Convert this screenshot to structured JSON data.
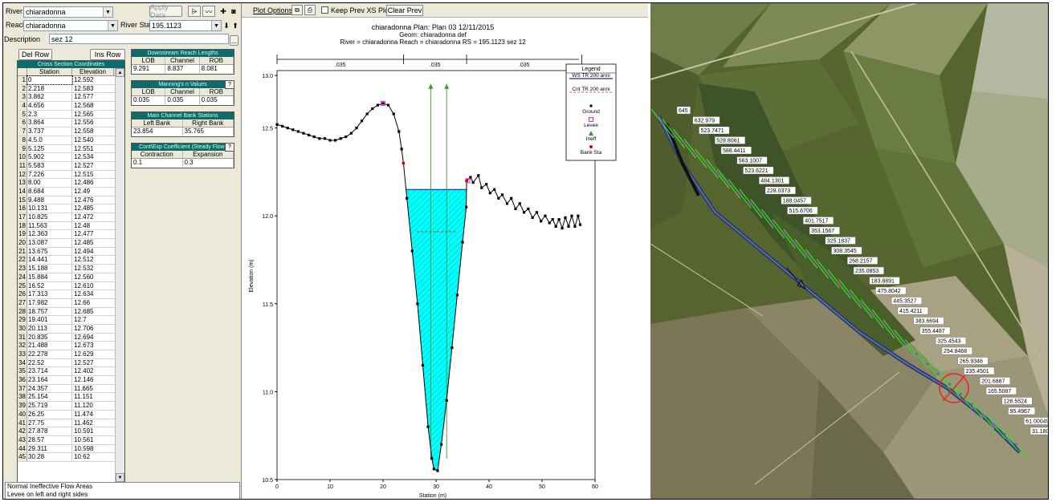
{
  "editor": {
    "river_label": "River:",
    "river_value": "chiaradonna",
    "reach_label": "Reach:",
    "reach_value": "chiaradonna",
    "river_sta_label": "River Sta.:",
    "river_sta_value": "195.1123",
    "description_label": "Description",
    "description_value": "sez 12",
    "apply_data_label": "Apply Data",
    "del_row_label": "Del Row",
    "ins_row_label": "Ins Row",
    "ellipsis_label": "...",
    "coord_title": "Cross Section Coordinates",
    "coord_headers": [
      "Station",
      "Elevation"
    ],
    "coords": [
      [
        "0",
        "12.592"
      ],
      [
        "2.218",
        "12.583"
      ],
      [
        "3.862",
        "12.577"
      ],
      [
        "4.656",
        "12.568"
      ],
      [
        "2.3",
        "12.565"
      ],
      [
        "3.864",
        "12.556"
      ],
      [
        "3.737",
        "12.558"
      ],
      [
        "4.5.0",
        "12.540"
      ],
      [
        "5.125",
        "12.551"
      ],
      [
        "5.902",
        "12.534"
      ],
      [
        "5.583",
        "12.527"
      ],
      [
        "7.226",
        "12.515"
      ],
      [
        "8.00",
        "12.486"
      ],
      [
        "8.684",
        "12.49"
      ],
      [
        "9.488",
        "12.476"
      ],
      [
        "10.131",
        "12.485"
      ],
      [
        "10.825",
        "12.472"
      ],
      [
        "11.563",
        "12.48"
      ],
      [
        "12.363",
        "12.477"
      ],
      [
        "13.087",
        "12.485"
      ],
      [
        "13.675",
        "12.494"
      ],
      [
        "14.441",
        "12.512"
      ],
      [
        "15.188",
        "12.532"
      ],
      [
        "15.884",
        "12.560"
      ],
      [
        "16.52",
        "12.610"
      ],
      [
        "17.313",
        "12.634"
      ],
      [
        "17.982",
        "12.66"
      ],
      [
        "18.757",
        "12.685"
      ],
      [
        "19.401",
        "12.7"
      ],
      [
        "20.113",
        "12.706"
      ],
      [
        "20.835",
        "12.694"
      ],
      [
        "21.488",
        "12.673"
      ],
      [
        "22.278",
        "12.629"
      ],
      [
        "22.52",
        "12.527"
      ],
      [
        "23.714",
        "12.402"
      ],
      [
        "23.164",
        "12.146"
      ],
      [
        "24.357",
        "11.665"
      ],
      [
        "25.154",
        "11.151"
      ],
      [
        "25.719",
        "11.120"
      ],
      [
        "26.25",
        "11.474"
      ],
      [
        "27.75",
        "11.462"
      ],
      [
        "27.878",
        "10.591"
      ],
      [
        "28.57",
        "10.561"
      ],
      [
        "29.311",
        "10.598"
      ],
      [
        "30.28",
        "10.62"
      ]
    ],
    "reach_lengths": {
      "title": "Downstream Reach Lengths",
      "headers": [
        "LOB",
        "Channel",
        "ROB"
      ],
      "values": [
        "9.291",
        "8.837",
        "8.081"
      ]
    },
    "mannings": {
      "title": "Manning's n Values",
      "help": "?",
      "headers": [
        "LOB",
        "Channel",
        "ROB"
      ],
      "values": [
        "0.035",
        "0.035",
        "0.035"
      ]
    },
    "bank_stations": {
      "title": "Main Channel Bank Stations",
      "headers": [
        "Left Bank",
        "Right Bank"
      ],
      "values": [
        "23.854",
        "35.765"
      ]
    },
    "coeff": {
      "title": "Cont\\Exp Coefficient (Steady Flow)",
      "help": "?",
      "headers": [
        "Contraction",
        "Expansion"
      ],
      "values": [
        "0.1",
        "0.3"
      ]
    },
    "status_lines": [
      "Normal Ineffective Flow Areas",
      "Levee on left and right sides"
    ]
  },
  "plot": {
    "toolbar": {
      "plot_options": "Plot Options",
      "keep_prev": "Keep Prev XS Plots",
      "clear_prev": "Clear Prev"
    },
    "title_line1": "chiaradonna        Plan: Plan 03    12/11/2015",
    "title_line2": "Geom: chiaradonna def",
    "title_line3": "River = chiaradonna   Reach = chiaradonna     RS = 195.1123   sez 12",
    "legend": {
      "title": "Legend",
      "items": [
        "WS TR 200 anni",
        "Crit TR 200 anni",
        "Ground",
        "Levee",
        "Ineff",
        "Bank Sta"
      ]
    },
    "colors": {
      "water": "#00ffff",
      "ground": "#000000",
      "ws": "#1e1ed0",
      "crit": "#cc3333",
      "levee": "#cc33cc",
      "ineff": "#339933",
      "bank": "#dd0000"
    },
    "n_values": [
      ".035",
      ".035",
      ".035"
    ]
  },
  "chart_data": {
    "type": "line",
    "title": "chiaradonna        Plan: Plan 03    12/11/2015",
    "xlabel": "Station (m)",
    "ylabel": "Elevation (m)",
    "xlim": [
      0,
      60
    ],
    "ylim": [
      10.5,
      13.0
    ],
    "xticks": [
      "0",
      "10",
      "20",
      "30",
      "40",
      "50",
      "60"
    ],
    "yticks": [
      "10.5",
      "11.0",
      "11.5",
      "12.0",
      "12.5",
      "13.0"
    ],
    "ground": [
      [
        0,
        12.52
      ],
      [
        1,
        12.51
      ],
      [
        2,
        12.5
      ],
      [
        3,
        12.49
      ],
      [
        4,
        12.48
      ],
      [
        5,
        12.47
      ],
      [
        6,
        12.46
      ],
      [
        7,
        12.45
      ],
      [
        8,
        12.44
      ],
      [
        9,
        12.44
      ],
      [
        10,
        12.43
      ],
      [
        11,
        12.43
      ],
      [
        12,
        12.44
      ],
      [
        13,
        12.45
      ],
      [
        14,
        12.47
      ],
      [
        15,
        12.5
      ],
      [
        16,
        12.54
      ],
      [
        17,
        12.58
      ],
      [
        18,
        12.61
      ],
      [
        19,
        12.63
      ],
      [
        20,
        12.64
      ],
      [
        21,
        12.63
      ],
      [
        22,
        12.58
      ],
      [
        23,
        12.48
      ],
      [
        23.5,
        12.38
      ],
      [
        23.85,
        12.3
      ],
      [
        24.5,
        12.1
      ],
      [
        25.5,
        11.8
      ],
      [
        26.5,
        11.5
      ],
      [
        27.5,
        11.15
      ],
      [
        28.5,
        10.8
      ],
      [
        29.2,
        10.62
      ],
      [
        29.6,
        10.56
      ],
      [
        30.3,
        10.55
      ],
      [
        31,
        10.7
      ],
      [
        32,
        10.95
      ],
      [
        33,
        11.25
      ],
      [
        34,
        11.55
      ],
      [
        35,
        11.85
      ],
      [
        35.7,
        12.05
      ],
      [
        35.77,
        12.2
      ],
      [
        36.5,
        12.22
      ],
      [
        37,
        12.19
      ],
      [
        38,
        12.23
      ],
      [
        38.6,
        12.16
      ],
      [
        39.5,
        12.18
      ],
      [
        40.2,
        12.13
      ],
      [
        41,
        12.15
      ],
      [
        41.8,
        12.1
      ],
      [
        42.5,
        12.12
      ],
      [
        43.4,
        12.07
      ],
      [
        44.2,
        12.1
      ],
      [
        45,
        12.04
      ],
      [
        45.8,
        12.07
      ],
      [
        46.6,
        12.02
      ],
      [
        47.4,
        12.04
      ],
      [
        48.2,
        11.99
      ],
      [
        49,
        12.02
      ],
      [
        49.8,
        11.97
      ],
      [
        50.6,
        12.0
      ],
      [
        51.4,
        11.96
      ],
      [
        52,
        11.98
      ],
      [
        52.6,
        11.94
      ],
      [
        53.2,
        11.98
      ],
      [
        53.8,
        11.93
      ],
      [
        54.4,
        11.99
      ],
      [
        55,
        11.94
      ],
      [
        55.6,
        12.0
      ],
      [
        56.2,
        11.94
      ],
      [
        56.8,
        12.0
      ],
      [
        57.2,
        11.95
      ]
    ],
    "water_surface": 12.15,
    "critical_ws": 11.91,
    "bank_stations": [
      23.854,
      35.765
    ],
    "levees": [
      [
        20,
        12.64
      ],
      [
        36,
        12.2
      ]
    ],
    "ineffective_stations": [
      29,
      32
    ]
  },
  "map": {
    "labels": [
      "645",
      "632.979",
      "523.7471",
      "528.8061",
      "588.4411",
      "563.1007",
      "523.6221",
      "484.1301",
      "228.0373",
      "188.0457",
      "515.6706",
      "401.7517",
      "353.1567",
      "325.1837",
      "308.3545",
      "268.2157",
      "235.0853",
      "183.8891",
      "475.8042",
      "445.3527",
      "415.4211",
      "383.6694",
      "355.4487",
      "325.4543",
      "294.8468",
      "265.9346",
      "235.4501",
      "201.6887",
      "165.5087",
      "126.5524",
      "95.4967",
      "61.00049",
      "31.1802"
    ]
  }
}
